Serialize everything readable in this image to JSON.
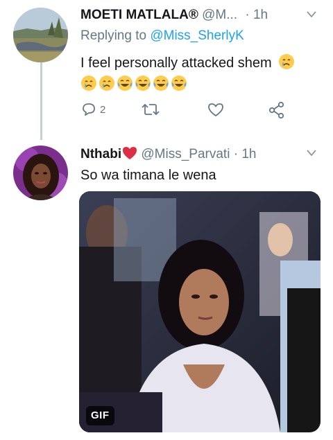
{
  "tweet1": {
    "display_name": "MOETI MATLALA®",
    "handle_truncated": "@M...",
    "time_label": "· 1h",
    "replying_prefix": "Replying to",
    "replying_handle": "@Miss_SherlyK",
    "text": "I feel personally attacked shem",
    "emojis": [
      "crying-face",
      "crying-face",
      "crying-face",
      "tears-of-joy",
      "tears-of-joy",
      "tears-of-joy",
      "tears-of-joy"
    ],
    "reply_count": "2",
    "icons": [
      "reply-icon",
      "retweet-icon",
      "like-icon",
      "share-icon",
      "chevron-down-icon"
    ]
  },
  "tweet2": {
    "display_name": "Nthabi",
    "handle": "@Miss_Parvati",
    "time_label": "· 1h",
    "text": "So wa timana le wena",
    "media_badge": "GIF",
    "icons": [
      "red-heart-icon",
      "chevron-down-icon"
    ]
  },
  "colors": {
    "secondary_text": "#657786",
    "link": "#1da1f2",
    "thread_line": "#c4cfd6",
    "heart": "#e0245e"
  }
}
